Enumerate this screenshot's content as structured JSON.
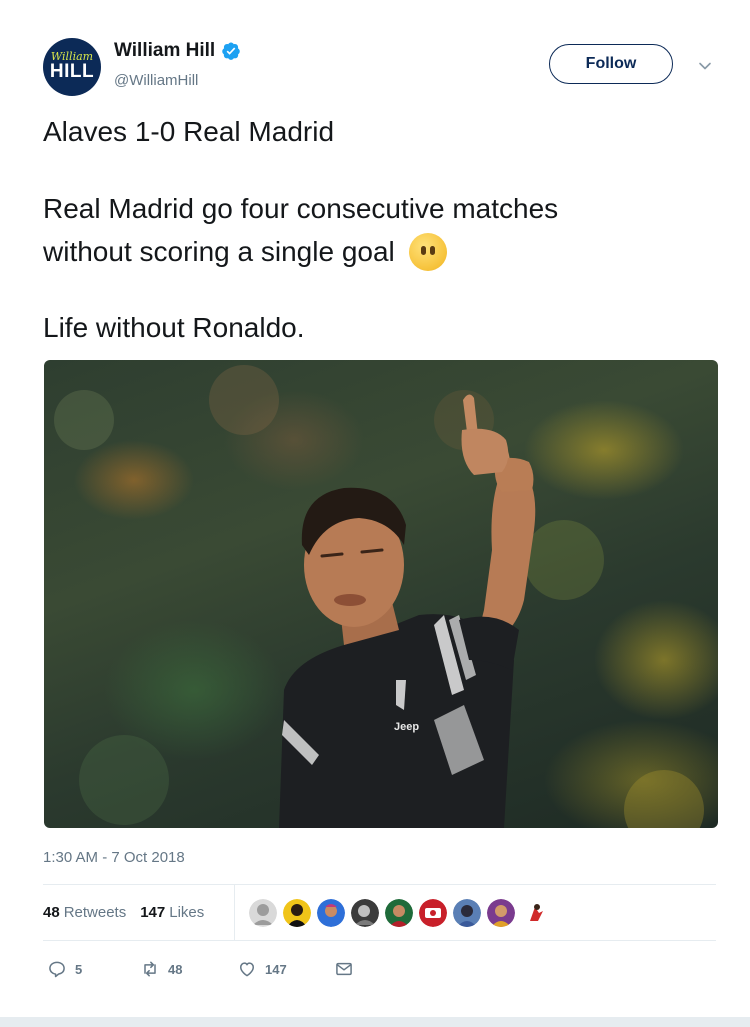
{
  "account": {
    "name": "William Hill",
    "handle": "@WilliamHill",
    "avatar_script": "William",
    "avatar_block": "HILL"
  },
  "follow_label": "Follow",
  "tweet": {
    "lines": [
      "Alaves 1-0 Real Madrid",
      "Real Madrid go four consecutive matches",
      "without scoring a single goal",
      "Life without Ronaldo."
    ],
    "emoji": "face-without-mouth"
  },
  "media": {
    "kit_text": "Jeep"
  },
  "timestamp": "1:30 AM - 7 Oct 2018",
  "stats": {
    "retweets_count": "48",
    "retweets_label": "Retweets",
    "likes_count": "147",
    "likes_label": "Likes"
  },
  "actions": {
    "replies": "5",
    "retweets": "48",
    "likes": "147"
  },
  "colors": {
    "brand": "#0c2a57",
    "verified": "#1da1f2",
    "muted": "#657786",
    "text": "#14171a",
    "divider": "#e6ecf0"
  },
  "icons": [
    "verified-badge-icon",
    "chevron-down-icon",
    "reply-icon",
    "retweet-icon",
    "heart-icon",
    "envelope-icon"
  ]
}
